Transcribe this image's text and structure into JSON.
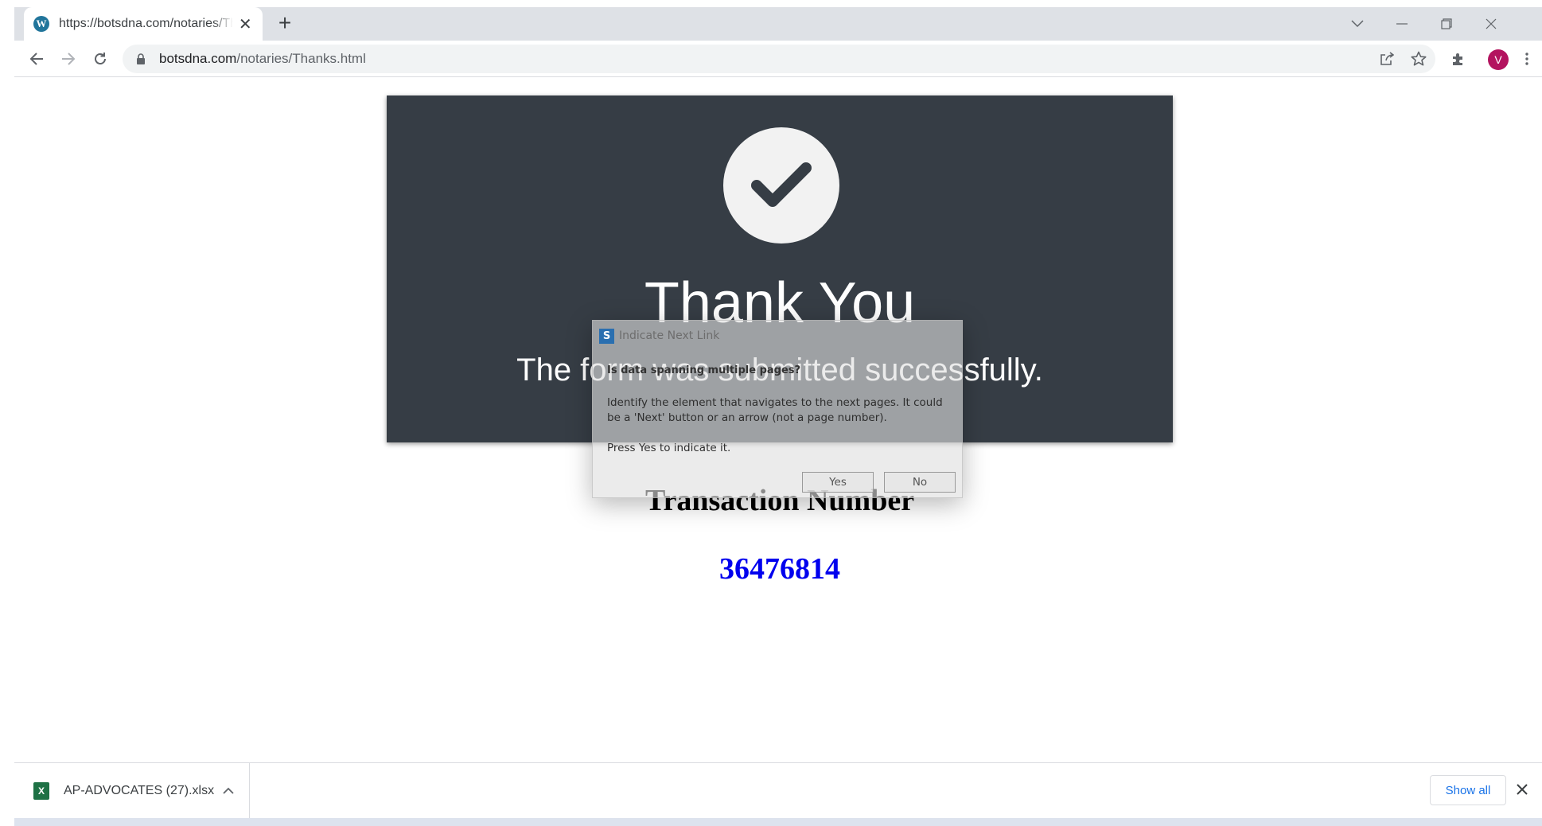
{
  "browser": {
    "tab_title": "https://botsdna.com/notaries/Thanks.html",
    "tab_favicon": "wordpress-icon",
    "url_domain": "botsdna.com",
    "url_path": "/notaries/Thanks.html",
    "profile_initial": "V",
    "profile_color": "#b3135f"
  },
  "page": {
    "heading": "Thank You",
    "message": "The form was submitted successfully.",
    "transaction_label": "Transaction Number",
    "transaction_number": "36476814",
    "banner_color": "#363d45",
    "number_color": "#0000ee"
  },
  "dialog": {
    "title": "Indicate Next Link",
    "question": "Is data spanning multiple pages?",
    "body": "Identify the element that navigates to the next pages. It could be a 'Next' button or an arrow (not a page number).",
    "instruction": "Press Yes to indicate it.",
    "yes_label": "Yes",
    "no_label": "No"
  },
  "download_shelf": {
    "file_name": "AP-ADVOCATES (27).xlsx",
    "show_all_label": "Show all"
  }
}
